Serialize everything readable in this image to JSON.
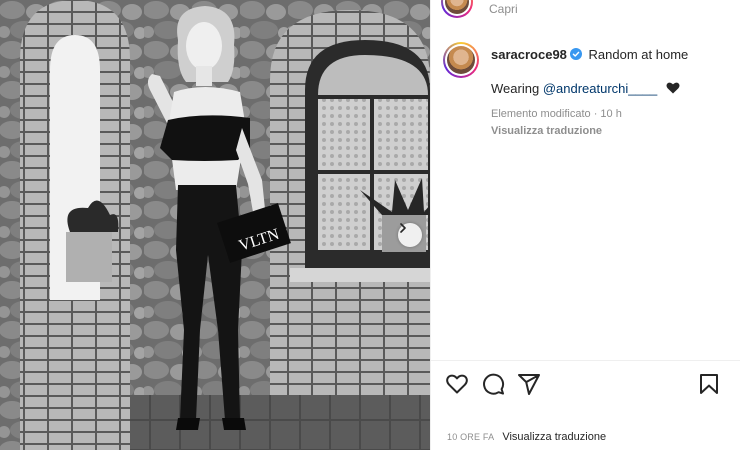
{
  "post": {
    "location": "Capri",
    "username": "saracroce98",
    "caption": "Random at home",
    "wearing_prefix": "Wearing",
    "mention": "@andreaturchi____",
    "meta": "Elemento modificato · 10 h",
    "see_translation": "Visualizza traduzione",
    "time_ago": "10 ORE FA",
    "footer_translation": "Visualizza traduzione"
  },
  "icons": {
    "verified": "verified-badge-icon",
    "heart": "black-heart-emoji",
    "like": "heart-outline-icon",
    "comment": "comment-bubble-icon",
    "share": "paper-plane-icon",
    "save": "bookmark-icon",
    "next": "chevron-right-icon"
  },
  "colors": {
    "verified": "#3897f0",
    "mention": "#00376b",
    "muted": "#8e8e8e",
    "text": "#262626"
  }
}
